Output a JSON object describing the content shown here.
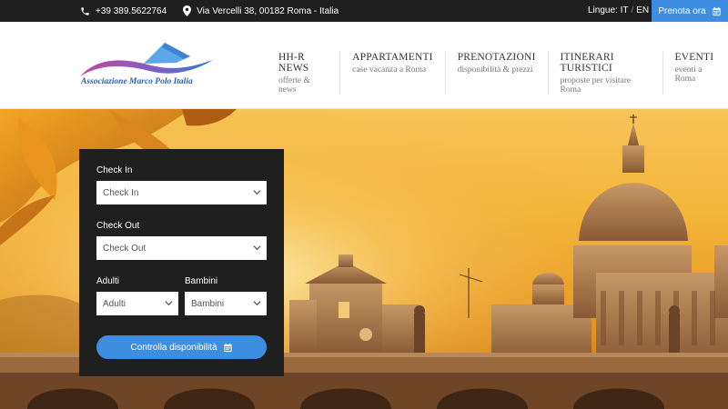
{
  "topbar": {
    "phone": "+39 389.5622764",
    "address": "Via Vercelli 38, 00182 Roma - Italia",
    "lang_label": "Lingue:",
    "lang_it": "IT",
    "lang_sep": "/",
    "lang_en": "EN",
    "book_label": "Prenota ora"
  },
  "logo": {
    "text": "Associazione Marco Polo Italia"
  },
  "nav": [
    {
      "title": "HH-R NEWS",
      "sub": "offerte & news"
    },
    {
      "title": "APPARTAMENTI",
      "sub": "case vacanza a Roma"
    },
    {
      "title": "PRENOTAZIONI",
      "sub": "disponibilità & prezzi"
    },
    {
      "title": "ITINERARI TURISTICI",
      "sub": "proposte per visitare Roma"
    },
    {
      "title": "EVENTI",
      "sub": "eventi a Roma"
    }
  ],
  "booking": {
    "checkin_label": "Check In",
    "checkin_value": "Check In",
    "checkout_label": "Check Out",
    "checkout_value": "Check Out",
    "adults_label": "Adulti",
    "adults_value": "Adulti",
    "children_label": "Bambini",
    "children_value": "Bambini",
    "submit_label": "Controlla disponibilità"
  },
  "colors": {
    "accent": "#3d8ee0",
    "dark": "#1f1f1f"
  }
}
